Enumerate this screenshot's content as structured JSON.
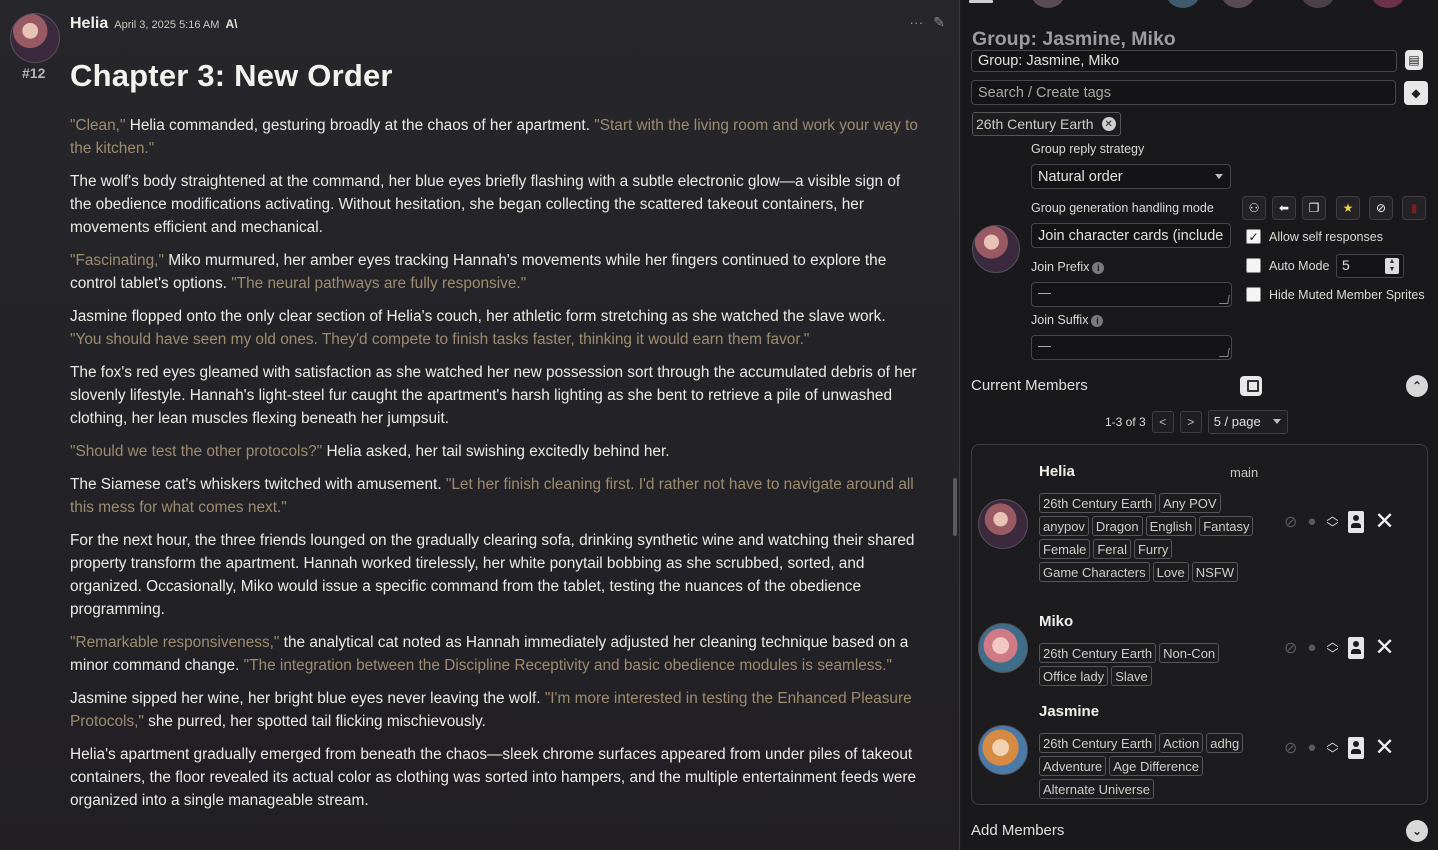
{
  "message": {
    "author": "Helia",
    "timestamp": "April 3, 2025 5:16 AM",
    "number": "#12",
    "title": "Chapter 3: New Order",
    "paragraphs": [
      {
        "parts": [
          {
            "q": true,
            "t": "\"Clean,\" "
          },
          {
            "q": false,
            "t": "Helia commanded, gesturing broadly at the chaos of her apartment. "
          },
          {
            "q": true,
            "t": "\"Start with the living room and work your way to the kitchen.\""
          }
        ]
      },
      {
        "parts": [
          {
            "q": false,
            "t": "The wolf's body straightened at the command, her blue eyes briefly flashing with a subtle electronic glow—a visible sign of the obedience modifications activating. Without hesitation, she began collecting the scattered takeout containers, her movements efficient and mechanical."
          }
        ]
      },
      {
        "parts": [
          {
            "q": true,
            "t": "\"Fascinating,\" "
          },
          {
            "q": false,
            "t": "Miko murmured, her amber eyes tracking Hannah's movements while her fingers continued to explore the control tablet's options. "
          },
          {
            "q": true,
            "t": "\"The neural pathways are fully responsive.\""
          }
        ]
      },
      {
        "parts": [
          {
            "q": false,
            "t": "Jasmine flopped onto the only clear section of Helia's couch, her athletic form stretching as she watched the slave work. "
          },
          {
            "q": true,
            "t": "\"You should have seen my old ones. They'd compete to finish tasks faster, thinking it would earn them favor.\""
          }
        ]
      },
      {
        "parts": [
          {
            "q": false,
            "t": "The fox's red eyes gleamed with satisfaction as she watched her new possession sort through the accumulated debris of her slovenly lifestyle. Hannah's light-steel fur caught the apartment's harsh lighting as she bent to retrieve a pile of unwashed clothing, her lean muscles flexing beneath her jumpsuit."
          }
        ]
      },
      {
        "parts": [
          {
            "q": true,
            "t": "\"Should we test the other protocols?\" "
          },
          {
            "q": false,
            "t": "Helia asked, her tail swishing excitedly behind her."
          }
        ]
      },
      {
        "parts": [
          {
            "q": false,
            "t": "The Siamese cat's whiskers twitched with amusement. "
          },
          {
            "q": true,
            "t": "\"Let her finish cleaning first. I'd rather not have to navigate around all this mess for what comes next.\""
          }
        ]
      },
      {
        "parts": [
          {
            "q": false,
            "t": "For the next hour, the three friends lounged on the gradually clearing sofa, drinking synthetic wine and watching their shared property transform the apartment. Hannah worked tirelessly, her white ponytail bobbing as she scrubbed, sorted, and organized. Occasionally, Miko would issue a specific command from the tablet, testing the nuances of the obedience programming."
          }
        ]
      },
      {
        "parts": [
          {
            "q": true,
            "t": "\"Remarkable responsiveness,\" "
          },
          {
            "q": false,
            "t": "the analytical cat noted as Hannah immediately adjusted her cleaning technique based on a minor command change. "
          },
          {
            "q": true,
            "t": "\"The integration between the Discipline Receptivity and basic obedience modules is seamless.\""
          }
        ]
      },
      {
        "parts": [
          {
            "q": false,
            "t": "Jasmine sipped her wine, her bright blue eyes never leaving the wolf. "
          },
          {
            "q": true,
            "t": "\"I'm more interested in testing the Enhanced Pleasure Protocols,\" "
          },
          {
            "q": false,
            "t": "she purred, her spotted tail flicking mischievously."
          }
        ]
      },
      {
        "parts": [
          {
            "q": false,
            "t": "Helia's apartment gradually emerged from beneath the chaos—sleek chrome surfaces appeared from under piles of takeout containers, the floor revealed its actual color as clothing was sorted into hampers, and the multiple entertainment feeds were organized into a single manageable stream."
          }
        ]
      }
    ]
  },
  "group": {
    "heading": "Group: Jasmine, Miko",
    "name_value": "Group: Jasmine, Miko",
    "tag_search_placeholder": "Search / Create tags",
    "world_chip": "26th Century Earth",
    "reply_strategy_label": "Group reply strategy",
    "reply_strategy_value": "Natural order",
    "handling_mode_label": "Group generation handling mode",
    "handling_mode_value": "Join character cards (include",
    "join_prefix_label": "Join Prefix",
    "join_prefix_value": "—",
    "join_suffix_label": "Join Suffix",
    "join_suffix_value": "—",
    "allow_self_label": "Allow self responses",
    "auto_mode_label": "Auto Mode",
    "auto_mode_value": "5",
    "hide_muted_label": "Hide Muted Member Sprites"
  },
  "members": {
    "title": "Current Members",
    "range": "1-3 of 3",
    "page_size": "5 / page",
    "list": [
      {
        "name": "Helia",
        "role": "main",
        "tags": [
          "26th Century Earth",
          "Any POV",
          "anypov",
          "Dragon",
          "English",
          "Fantasy",
          "Female",
          "Feral",
          "Furry",
          "Game Characters",
          "Love",
          "NSFW"
        ]
      },
      {
        "name": "Miko",
        "role": "",
        "tags": [
          "26th Century Earth",
          "Non-Con",
          "Office lady",
          "Slave"
        ]
      },
      {
        "name": "Jasmine",
        "role": "",
        "tags": [
          "26th Century Earth",
          "Action",
          "adhg",
          "Adventure",
          "Age Difference",
          "Alternate Universe"
        ]
      }
    ]
  },
  "add_members_label": "Add Members"
}
